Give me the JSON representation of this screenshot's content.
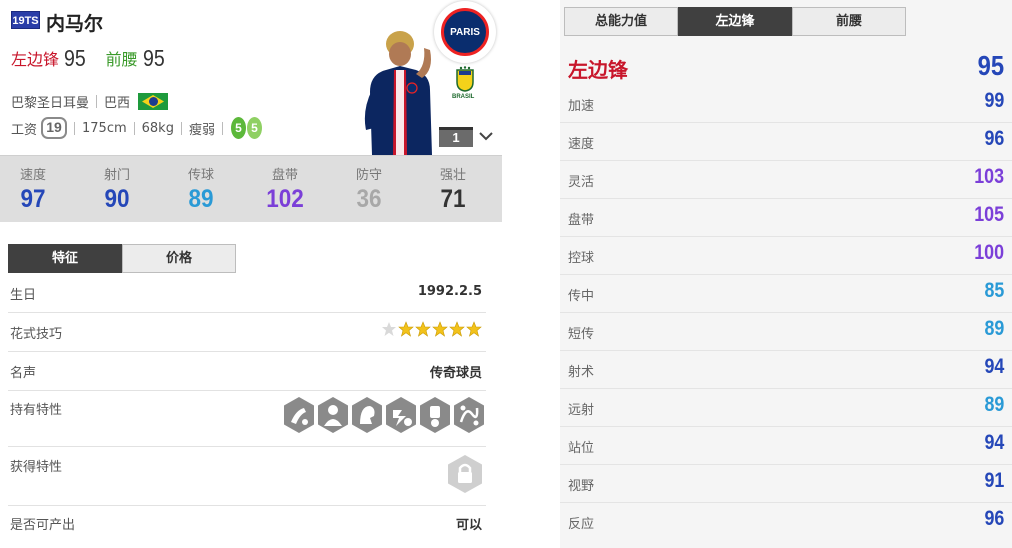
{
  "player": {
    "season": "19TS",
    "name": "内马尔",
    "positions": [
      {
        "label": "左边锋",
        "value": "95",
        "color": "#c8162b"
      },
      {
        "label": "前腰",
        "value": "95",
        "color": "#3a9a2a"
      }
    ],
    "club": "巴黎圣日耳曼",
    "nation": "巴西",
    "salary_label": "工资",
    "salary": "19",
    "height": "175cm",
    "weight": "68kg",
    "body_type": "瘦弱",
    "weak_foot": "5",
    "strong_foot": "5",
    "club_logo_text": "PARIS",
    "nation_badge_text": "BRASIL",
    "enhance_level": "1",
    "icons": [
      "psg-club-icon",
      "cbf-icon",
      "player-photo",
      "chevron-down-icon",
      "star-icon",
      "lock-icon"
    ]
  },
  "stats": [
    {
      "label": "速度",
      "value": "97",
      "color": "#2547b8"
    },
    {
      "label": "射门",
      "value": "90",
      "color": "#2547b8"
    },
    {
      "label": "传球",
      "value": "89",
      "color": "#2a9ad6"
    },
    {
      "label": "盘带",
      "value": "102",
      "color": "#7b3fd8"
    },
    {
      "label": "防守",
      "value": "36",
      "color": "#a8a8a8"
    },
    {
      "label": "强壮",
      "value": "71",
      "color": "#333333"
    }
  ],
  "left_tabs": [
    {
      "label": "特征",
      "active": true
    },
    {
      "label": "价格",
      "active": false
    }
  ],
  "attributes": {
    "birthday_label": "生日",
    "birthday": "1992.2.5",
    "skill_label": "花式技巧",
    "skill_stars": 5,
    "skill_stars_max": 6,
    "reputation_label": "名声",
    "reputation": "传奇球员",
    "traits_label": "持有特性",
    "trait_icons": [
      "flair-trait-icon",
      "selfish-trait-icon",
      "finesse-trait-icon",
      "speed-dribbler-trait-icon",
      "diver-trait-icon",
      "playmaker-trait-icon"
    ],
    "acquired_label": "获得特性",
    "tradable_label": "是否可产出",
    "tradable": "可以"
  },
  "right_tabs": [
    {
      "label": "总能力值",
      "active": false
    },
    {
      "label": "左边锋",
      "active": true
    },
    {
      "label": "前腰",
      "active": false
    }
  ],
  "position_detail": {
    "title": "左边锋",
    "total": "95",
    "rows": [
      {
        "label": "加速",
        "value": "99",
        "color": "#2547b8"
      },
      {
        "label": "速度",
        "value": "96",
        "color": "#2547b8"
      },
      {
        "label": "灵活",
        "value": "103",
        "color": "#7b3fd8"
      },
      {
        "label": "盘带",
        "value": "105",
        "color": "#7b3fd8"
      },
      {
        "label": "控球",
        "value": "100",
        "color": "#7b3fd8"
      },
      {
        "label": "传中",
        "value": "85",
        "color": "#2a9ad6"
      },
      {
        "label": "短传",
        "value": "89",
        "color": "#2a9ad6"
      },
      {
        "label": "射术",
        "value": "94",
        "color": "#2547b8"
      },
      {
        "label": "远射",
        "value": "89",
        "color": "#2a9ad6"
      },
      {
        "label": "站位",
        "value": "94",
        "color": "#2547b8"
      },
      {
        "label": "视野",
        "value": "91",
        "color": "#2547b8"
      },
      {
        "label": "反应",
        "value": "96",
        "color": "#2547b8"
      }
    ]
  }
}
